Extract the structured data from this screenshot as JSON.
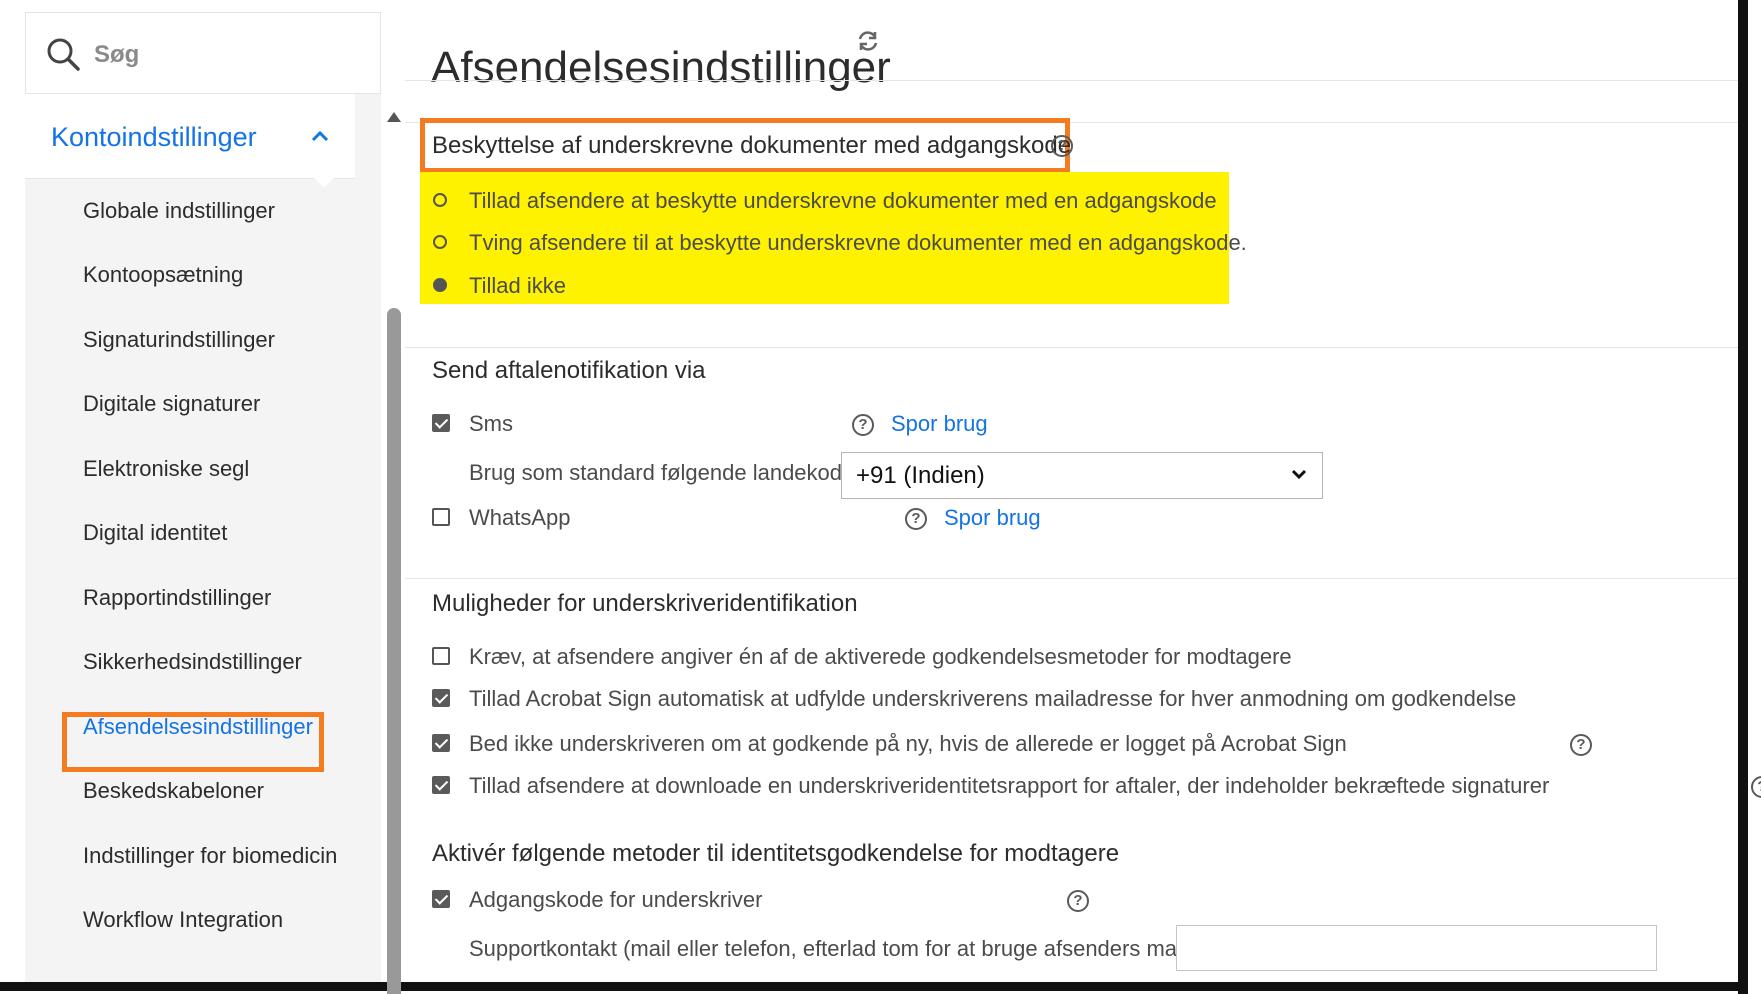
{
  "sidebar": {
    "search_placeholder": "Søg",
    "section": "Kontoindstillinger",
    "items": [
      {
        "label": "Globale indstillinger"
      },
      {
        "label": "Kontoopsætning"
      },
      {
        "label": "Signaturindstillinger"
      },
      {
        "label": "Digitale signaturer"
      },
      {
        "label": "Elektroniske segl"
      },
      {
        "label": "Digital identitet"
      },
      {
        "label": "Rapportindstillinger"
      },
      {
        "label": "Sikkerhedsindstillinger"
      },
      {
        "label": "Afsendelsesindstillinger",
        "active": true
      },
      {
        "label": "Beskedskabeloner"
      },
      {
        "label": "Indstillinger for biomedicin"
      },
      {
        "label": "Workflow Integration"
      }
    ]
  },
  "main": {
    "title": "Afsendelsesindstillinger",
    "password_protection": {
      "title": "Beskyttelse af underskrevne dokumenter med adgangskode",
      "options": [
        {
          "label": "Tillad afsendere at beskytte underskrevne dokumenter med en adgangskode",
          "selected": false
        },
        {
          "label": "Tving afsendere til at beskytte underskrevne dokumenter med en adgangskode.",
          "selected": false
        },
        {
          "label": "Tillad ikke",
          "selected": true
        }
      ]
    },
    "notification": {
      "title": "Send aftalenotifikation via",
      "sms_label": "Sms",
      "sms_checked": true,
      "sms_link": "Spor brug",
      "country_code_label": "Brug som standard følgende landekode:",
      "country_code_value": "+91 (Indien)",
      "whatsapp_label": "WhatsApp",
      "whatsapp_checked": false,
      "whatsapp_link": "Spor brug"
    },
    "signer_id": {
      "title": "Muligheder for underskriveridentifikation",
      "items": [
        {
          "label": "Kræv, at afsendere angiver én af de aktiverede godkendelsesmetoder for modtagere",
          "checked": false
        },
        {
          "label": "Tillad Acrobat Sign automatisk at udfylde underskriverens mailadresse for hver anmodning om godkendelse",
          "checked": true
        },
        {
          "label": "Bed ikke underskriveren om at godkende på ny, hvis de allerede er logget på Acrobat Sign",
          "checked": true
        },
        {
          "label": "Tillad afsendere at downloade en underskriveridentitetsrapport for aftaler, der indeholder bekræftede signaturer",
          "checked": true
        }
      ]
    },
    "identity_methods": {
      "title": "Aktivér følgende metoder til identitetsgodkendelse for modtagere",
      "password_label": "Adgangskode for underskriver",
      "password_checked": true,
      "support_label": "Supportkontakt (mail eller telefon, efterlad tom for at bruge afsenders mail):",
      "support_value": ""
    }
  },
  "colors": {
    "accent": "#1473e6",
    "highlight_orange": "#f47b20",
    "highlight_yellow": "#fff200"
  }
}
